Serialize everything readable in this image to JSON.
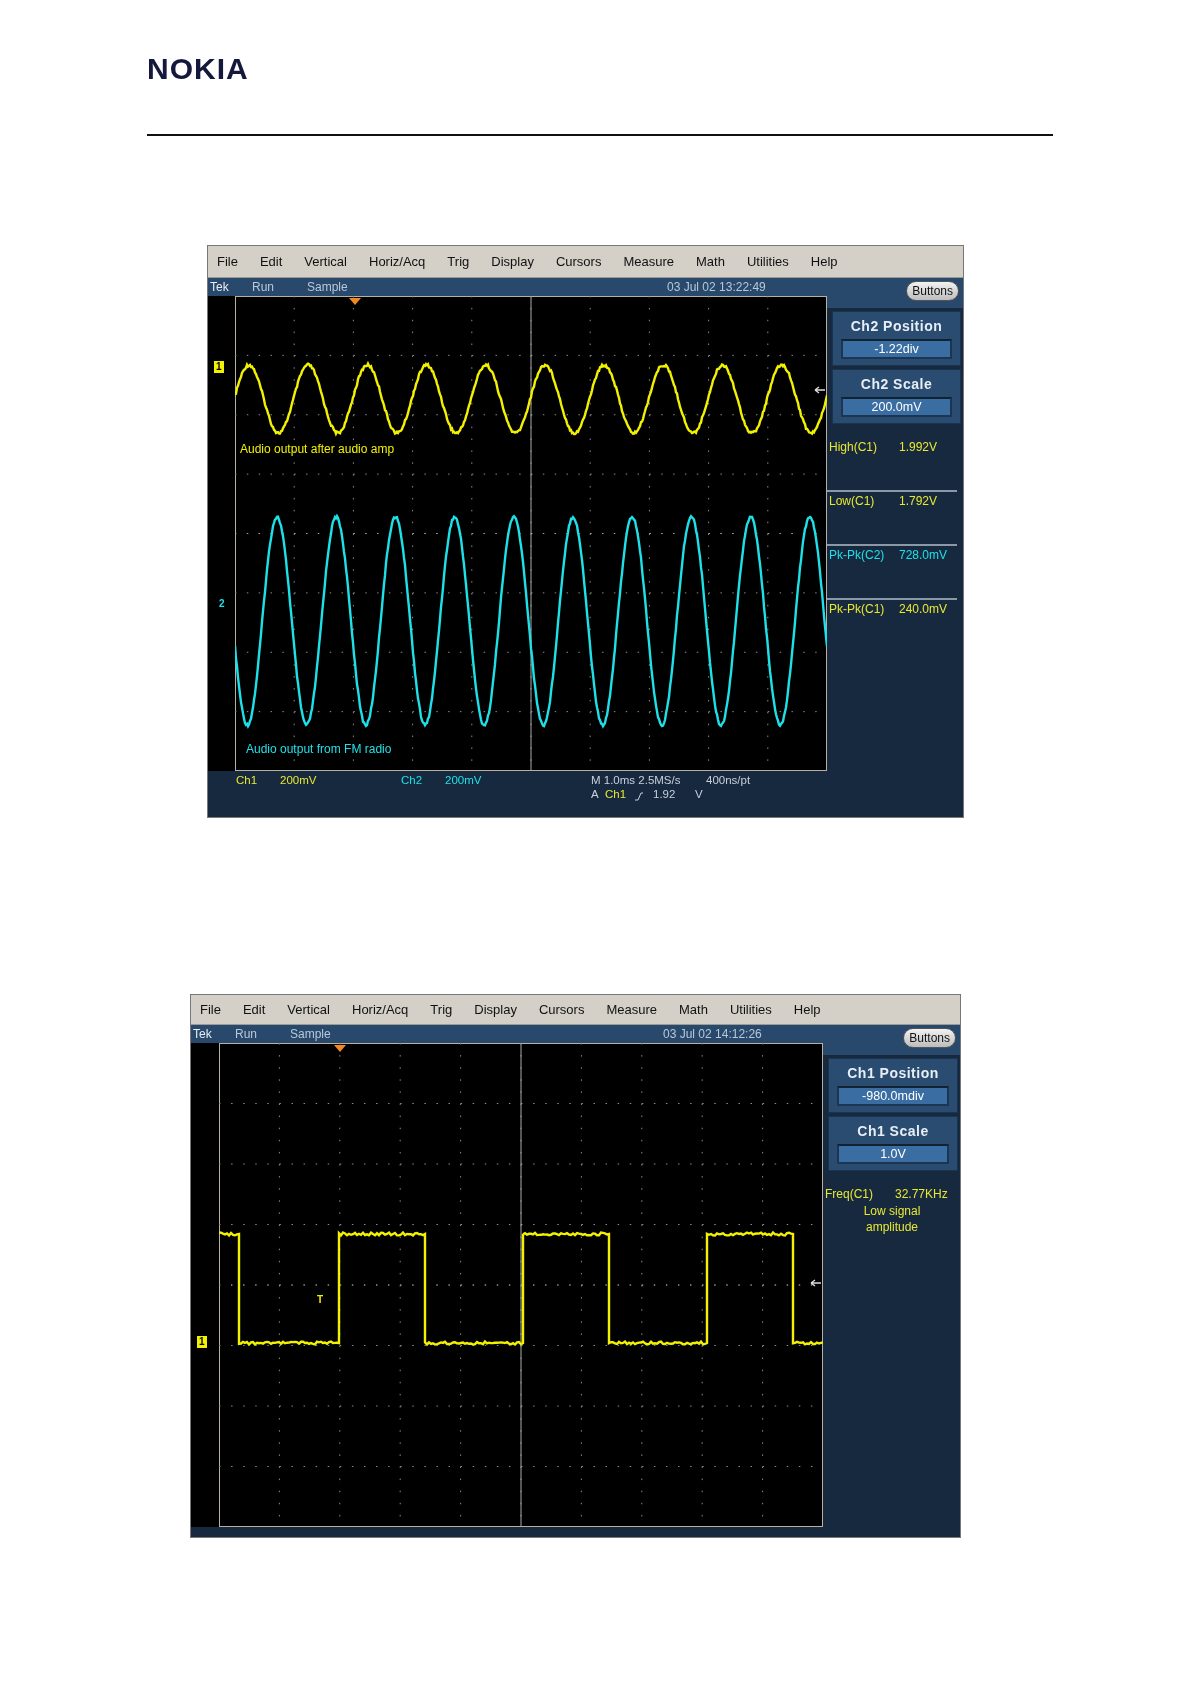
{
  "logo": "NOKIA",
  "scopes": [
    {
      "menu": [
        "File",
        "Edit",
        "Vertical",
        "Horiz/Acq",
        "Trig",
        "Display",
        "Cursors",
        "Measure",
        "Math",
        "Utilities",
        "Help"
      ],
      "status": {
        "brand": "Tek",
        "mode": "Run",
        "acquisition": "Sample",
        "timestamp": "03 Jul 02 13:22:49"
      },
      "buttons_label": "Buttons",
      "controls": [
        {
          "title": "Ch2 Position",
          "value": "-1.22div"
        },
        {
          "title": "Ch2 Scale",
          "value": "200.0mV"
        }
      ],
      "traces": [
        {
          "marker": "1",
          "label": "Audio output after audio amp",
          "color": "#f2f200",
          "kind": "sine"
        },
        {
          "marker": "2",
          "label": "Audio output from FM radio",
          "color": "#1ee0e8",
          "kind": "sine"
        }
      ],
      "measurements": [
        {
          "name": "High(C1)",
          "value": "1.992V",
          "color": "#e8e830"
        },
        {
          "name": "Low(C1)",
          "value": "1.792V",
          "color": "#e8e830"
        },
        {
          "name": "Pk-Pk(C2)",
          "value": "728.0mV",
          "color": "#1ee0e8"
        },
        {
          "name": "Pk-Pk(C1)",
          "value": "240.0mV",
          "color": "#e8e830"
        }
      ],
      "readout": {
        "channels": [
          {
            "name": "Ch1",
            "scale": "200mV",
            "color": "#e8e830"
          },
          {
            "name": "Ch2",
            "scale": "200mV",
            "color": "#1ee0e8"
          }
        ],
        "timebase": "M 1.0ms 2.5MS/s",
        "resolution": "400ns/pt",
        "trigger": {
          "prefix": "A",
          "source": "Ch1",
          "color": "#e8e830",
          "level": "1.92",
          "unit": "V"
        }
      }
    },
    {
      "menu": [
        "File",
        "Edit",
        "Vertical",
        "Horiz/Acq",
        "Trig",
        "Display",
        "Cursors",
        "Measure",
        "Math",
        "Utilities",
        "Help"
      ],
      "status": {
        "brand": "Tek",
        "mode": "Run",
        "acquisition": "Sample",
        "timestamp": "03 Jul 02 14:12:26"
      },
      "buttons_label": "Buttons",
      "controls": [
        {
          "title": "Ch1 Position",
          "value": "-980.0mdiv"
        },
        {
          "title": "Ch1 Scale",
          "value": "1.0V"
        }
      ],
      "traces": [
        {
          "marker": "1",
          "trigger_mark": "T",
          "color": "#f2f200",
          "kind": "square"
        }
      ],
      "measurements": [
        {
          "name": "Freq(C1)",
          "value": "32.77KHz",
          "color": "#e8e830",
          "note": "Low signal amplitude"
        }
      ]
    }
  ]
}
